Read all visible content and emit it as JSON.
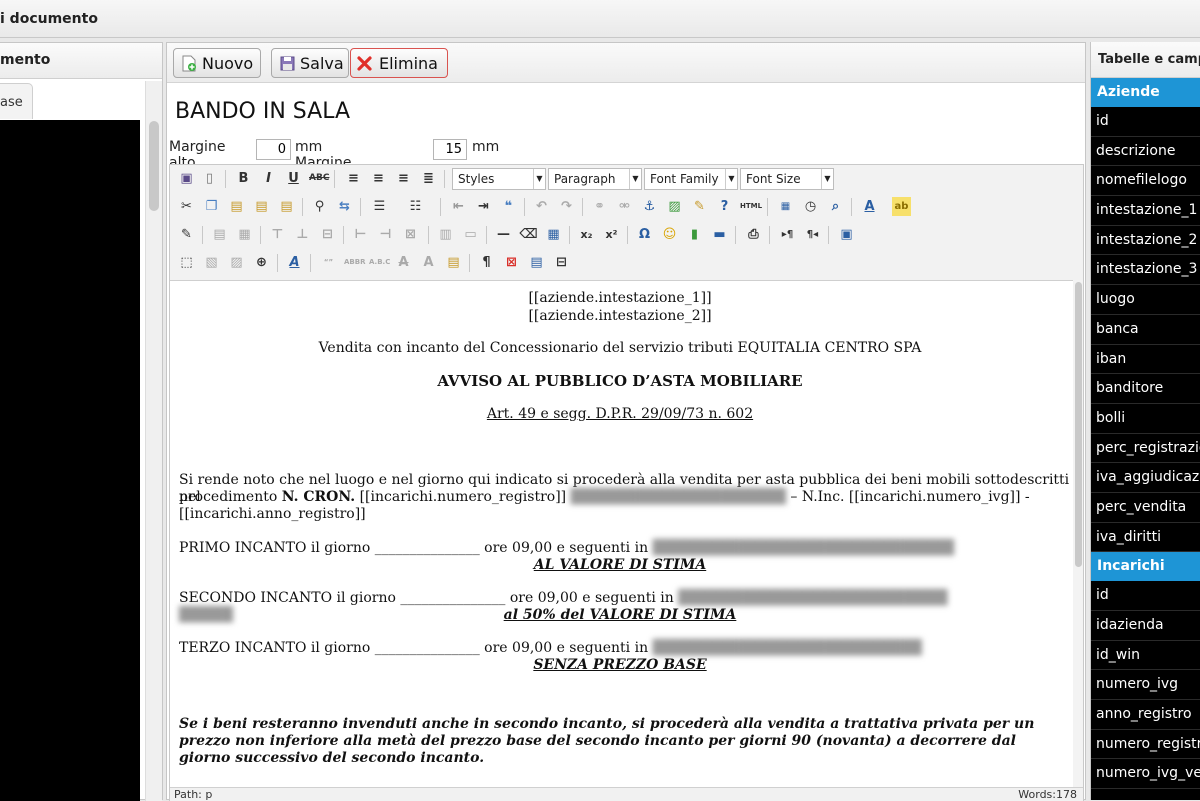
{
  "window": {
    "title": "i documento"
  },
  "left_panel": {
    "header": "mento",
    "tab_label": "ase"
  },
  "toolbar": {
    "new_label": "Nuovo",
    "save_label": "Salva",
    "delete_label": "Elimina"
  },
  "document": {
    "title": "BANDO IN SALA",
    "margin_top_label": "Margine alto",
    "margin_top_value": "0",
    "margin_left_label": "mm Margine sinistro",
    "margin_left_value": "15",
    "mm_label": "mm"
  },
  "editor": {
    "styles_select": "Styles",
    "format_select": "Paragraph",
    "font_family_select": "Font Family",
    "font_size_select": "Font Size",
    "path_label": "Path: p",
    "word_count": "Words:178"
  },
  "content": {
    "line1": "[[aziende.intestazione_1]]",
    "line2": "[[aziende.intestazione_2]]",
    "line3": "Vendita con incanto del Concessionario del servizio tributi EQUITALIA CENTRO SPA",
    "heading": "AVVISO AL PUBBLICO D’ASTA MOBILIARE",
    "subheading": "Art. 49 e segg. D.P.R. 29/09/73 n. 602",
    "para1_a": "Si rende noto che nel luogo e nel giorno qui indicato si procederà alla vendita per asta pubblica dei beni mobili sottodescritti nel",
    "para1_b_prefix": "procedimento ",
    "para1_b_bold": "N. CRON.",
    "para1_b_mid": " [[incarichi.numero_registro]]",
    "para1_b_suffix": " – N.Inc. [[incarichi.numero_ivg]] -",
    "para1_c": "[[incarichi.anno_registro]]",
    "primo": " PRIMO INCANTO il giorno  _______________ ore 09,00 e seguenti in",
    "primo_value": "AL VALORE DI STIMA",
    "secondo": "SECONDO INCANTO il giorno  _______________ ore 09,00 e seguenti in",
    "secondo_value": "al 50% del VALORE DI STIMA",
    "terzo": "TERZO INCANTO il giorno  _______________ ore 09,00 e seguenti in",
    "terzo_value": "SENZA PREZZO BASE",
    "final_1": "Se i beni resteranno invenduti anche in secondo incanto, si procederà alla vendita a trattativa privata per un",
    "final_2": "prezzo non inferiore alla metà del prezzo base del secondo incanto per giorni 90 (novanta) a decorrere dal",
    "final_3": "giorno successivo del secondo incanto."
  },
  "right_panel": {
    "header": "Tabelle e campi",
    "aziende_label": "Aziende",
    "aziende_fields": [
      "id",
      "descrizione",
      "nomefilelogo",
      "intestazione_1",
      "intestazione_2",
      "intestazione_3",
      "luogo",
      "banca",
      "iban",
      "banditore",
      "bolli",
      "perc_registrazione",
      "iva_aggiudicazione",
      "perc_vendita",
      "iva_diritti"
    ],
    "incarichi_label": "Incarichi",
    "incarichi_fields": [
      "id",
      "idazienda",
      "id_win",
      "numero_ivg",
      "anno_registro",
      "numero_registro",
      "numero_ivg_vecchio"
    ]
  },
  "colors": {
    "group_header": "#1e95d6",
    "delete_border": "#d9534f"
  }
}
